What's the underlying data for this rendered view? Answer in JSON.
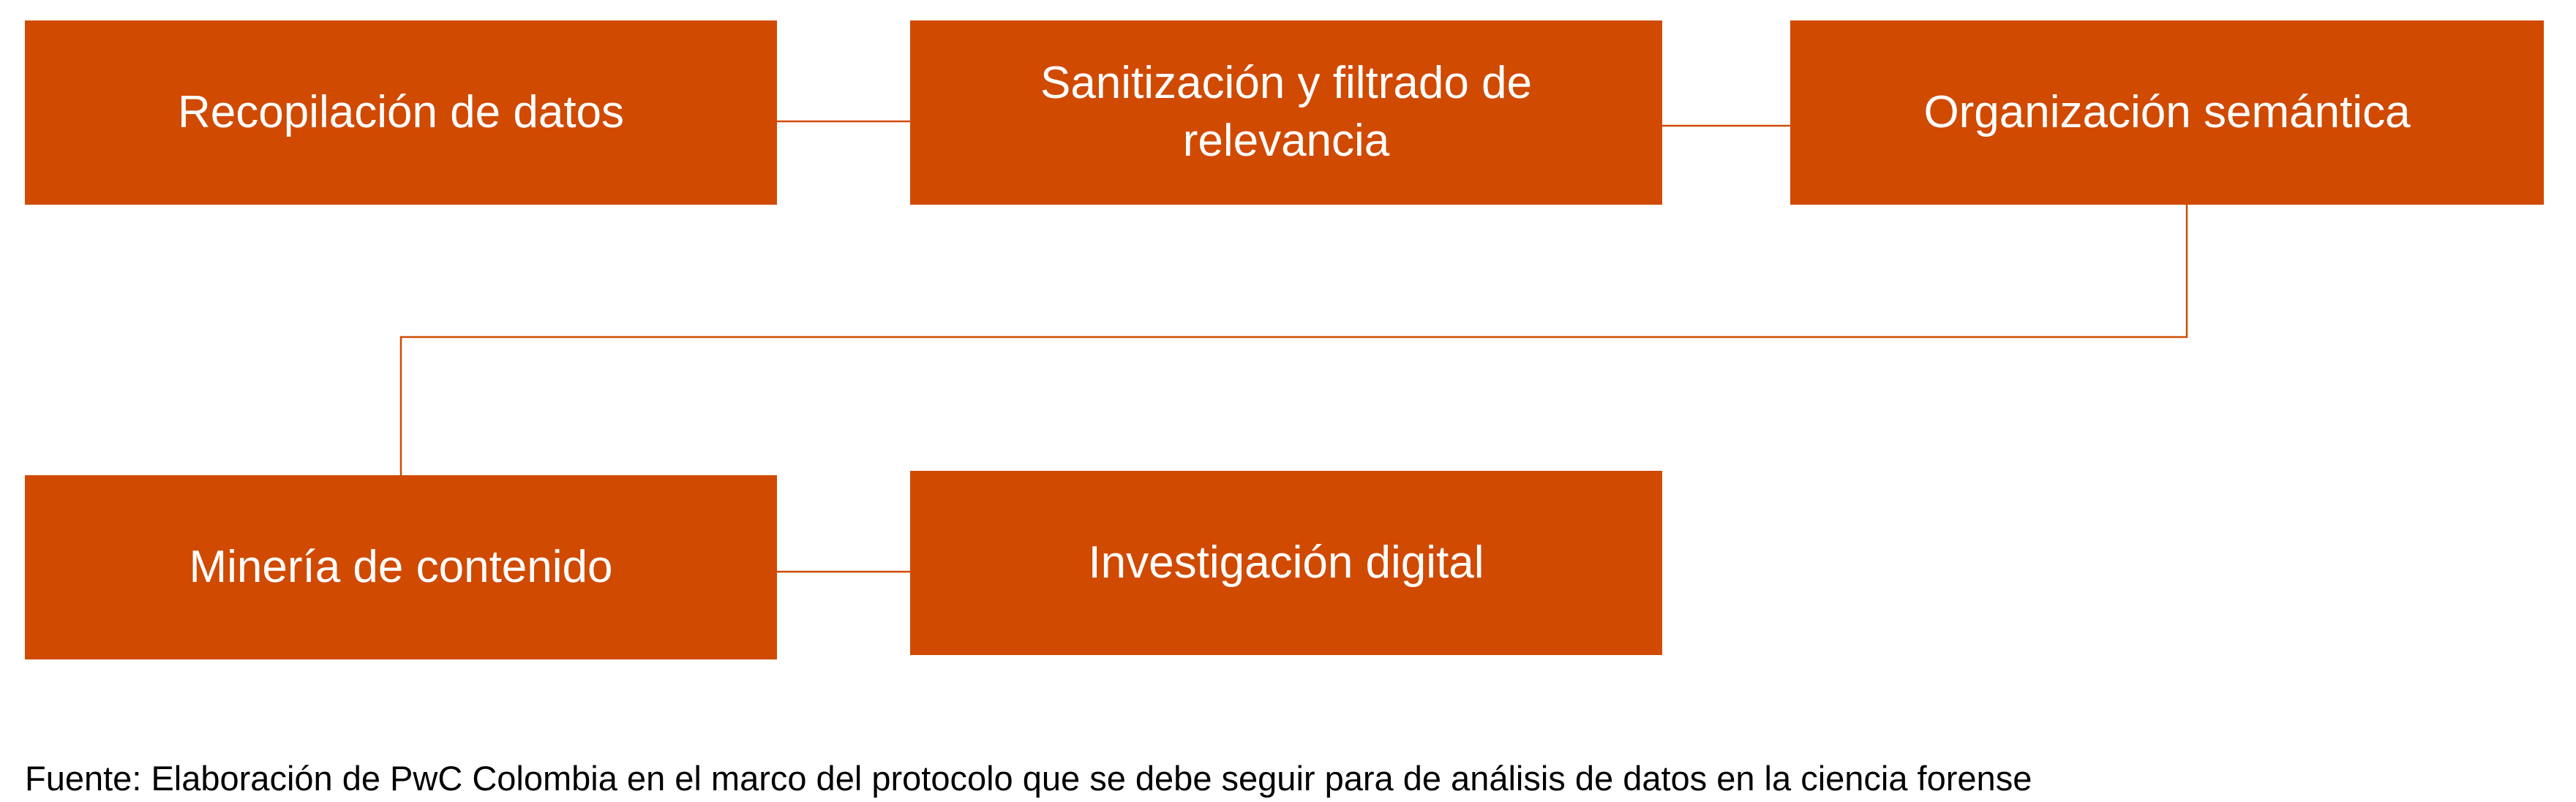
{
  "diagram": {
    "steps": [
      {
        "label": "Recopilación de datos"
      },
      {
        "label": "Sanitización y filtrado de relevancia"
      },
      {
        "label": "Organización semántica"
      },
      {
        "label": "Minería de contenido"
      },
      {
        "label": "Investigación digital"
      }
    ],
    "box_color": "#d04a02",
    "connector_color": "#d04a02",
    "text_color": "#ffffff"
  },
  "source_note": "Fuente: Elaboración de PwC Colombia en el marco del protocolo que se debe seguir para de análisis de datos en la ciencia forense"
}
